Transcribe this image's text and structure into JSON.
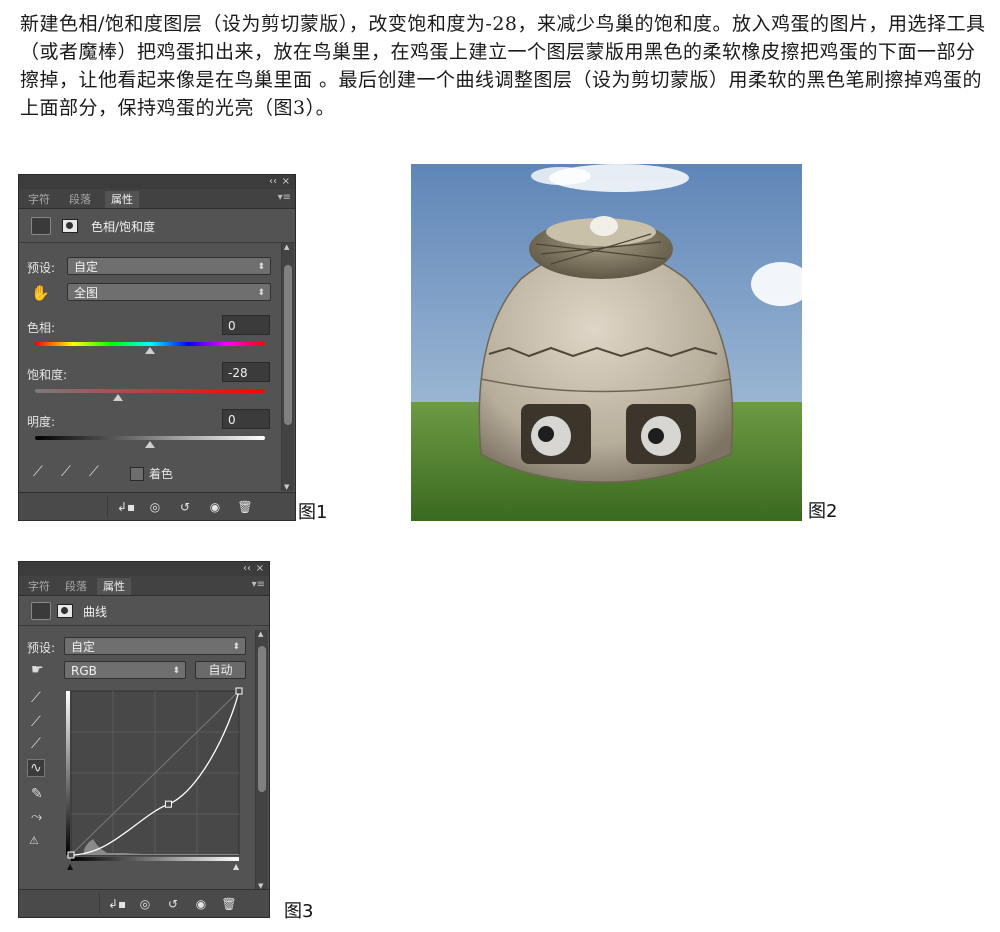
{
  "intro_text": "新建色相/饱和度图层（设为剪切蒙版），改变饱和度为-28，来减少鸟巢的饱和度。放入鸡蛋的图片，用选择工具（或者魔棒）把鸡蛋扣出来，放在鸟巢里，在鸡蛋上建立一个图层蒙版用黑色的柔软橡皮擦把鸡蛋的下面一部分擦掉，让他看起来像是在鸟巢里面 。最后创建一个曲线调整图层（设为剪切蒙版）用柔软的黑色笔刷擦掉鸡蛋的上面部分，保持鸡蛋的光亮（图3）。",
  "panel1": {
    "top_controls": {
      "collapse": "‹‹",
      "close": "×"
    },
    "tabs": [
      "字符",
      "段落",
      "属性"
    ],
    "active_tab": "属性",
    "title": "色相/饱和度",
    "preset_label": "预设:",
    "preset_value": "自定",
    "range_value": "全图",
    "hue_label": "色相:",
    "hue_value": "0",
    "saturation_label": "饱和度:",
    "saturation_value": "-28",
    "lightness_label": "明度:",
    "lightness_value": "0",
    "hue_level": 0.5,
    "saturation_level": 0.36,
    "lightness_level": 0.5,
    "colorize_label": "着色",
    "caption": "图1"
  },
  "photo": {
    "caption": "图2",
    "colors": {
      "sky_top": "#5f86b8",
      "sky_bottom": "#b8cde0",
      "grass": "#4f7d2c",
      "skull": "#c8bfae",
      "nest": "#8c8368"
    }
  },
  "panel2": {
    "top_controls": {
      "collapse": "‹‹",
      "close": "×"
    },
    "tabs": [
      "字符",
      "段落",
      "属性"
    ],
    "active_tab": "属性",
    "title": "曲线",
    "preset_label": "预设:",
    "preset_value": "自定",
    "channel_value": "RGB",
    "auto_label": "自动",
    "caption": "图3",
    "curve_points": [
      [
        0,
        0
      ],
      [
        0.58,
        0.31
      ],
      [
        1,
        1
      ]
    ]
  }
}
